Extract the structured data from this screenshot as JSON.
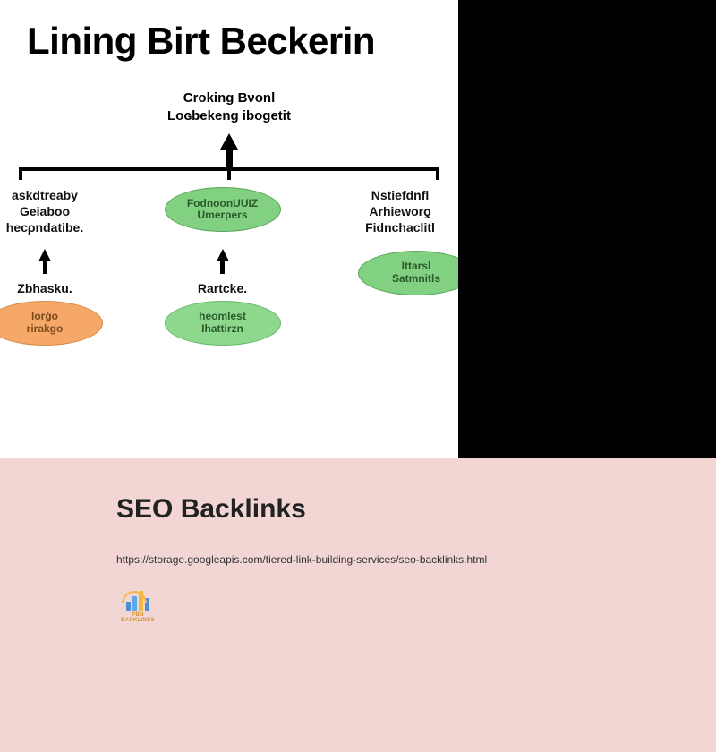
{
  "diagram": {
    "title": "Lining Birt Beckerin",
    "subtitle_line1": "Croking Bνonl",
    "subtitle_line2": "Loɢbekeng iboɡetit",
    "columns": [
      {
        "text_line1": "askdtreaby",
        "text_line2": "Geiaboo",
        "text_line3": "hecρndatibe.",
        "ellipse_top_line1": "",
        "ellipse_top_line2": "",
        "label_under_arrow": "Zbhasku.",
        "ellipse_bottom_line1": "lorǵo",
        "ellipse_bottom_line2": "rirakgo"
      },
      {
        "text_line1": "",
        "text_line2": "",
        "text_line3": "",
        "ellipse_top_line1": "FodnoonUUIZ",
        "ellipse_top_line2": "Umerpers",
        "label_under_arrow": "Rartcke.",
        "ellipse_bottom_line1": "heomlest",
        "ellipse_bottom_line2": "Ihattirzn"
      },
      {
        "text_line1": "Nstiefdnfl",
        "text_line2": "Arhieworƍ",
        "text_line3": "Fidnchaclitl",
        "ellipse_top_line1": "",
        "ellipse_top_line2": "",
        "label_under_arrow": "",
        "ellipse_bottom_line1": "Ittarsl",
        "ellipse_bottom_line2": "Satmnitls"
      }
    ]
  },
  "lower": {
    "title": "SEO Backlinks",
    "url": "https://storage.googleapis.com/tiered-link-building-services/seo-backlinks.html",
    "logo_text": "PBN BACKLINKS"
  }
}
